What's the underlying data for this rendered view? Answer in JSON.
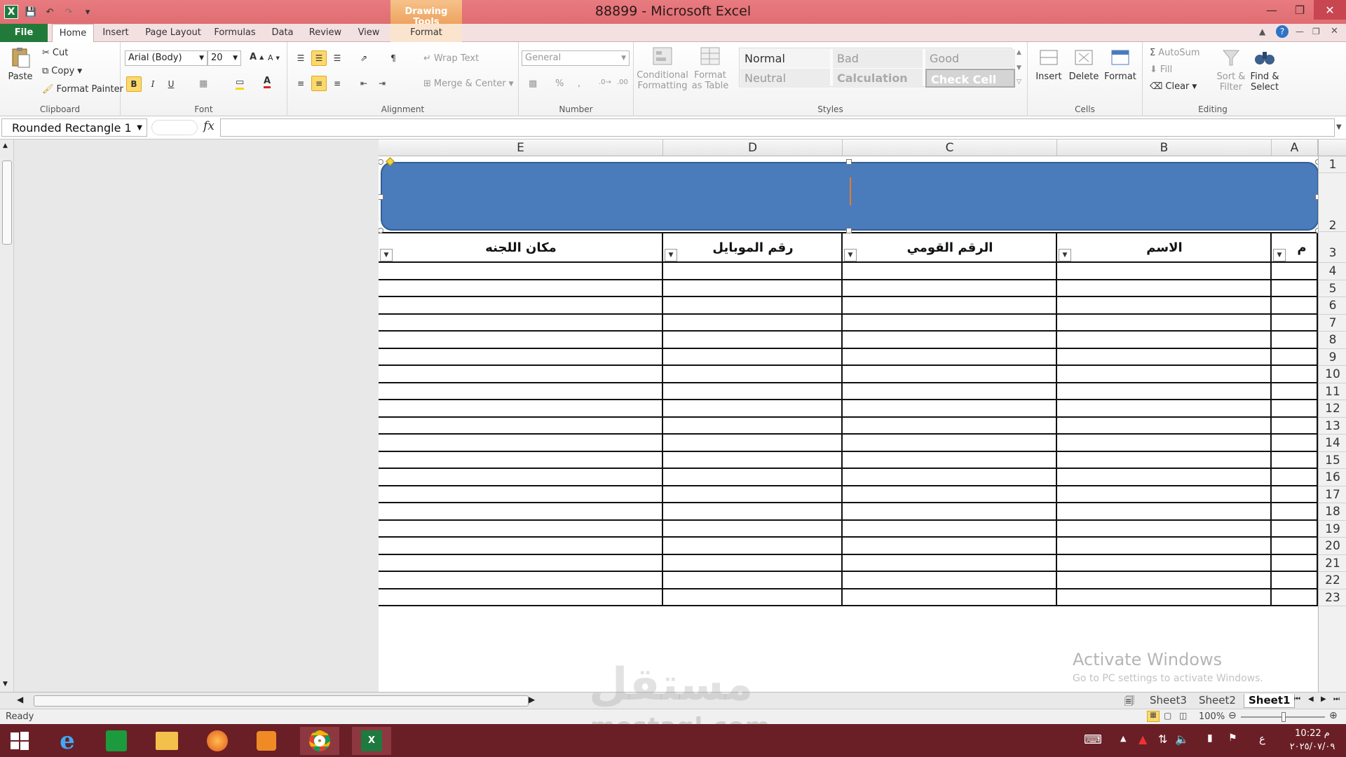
{
  "window": {
    "title": "88899 - Microsoft Excel",
    "context_tab_group": "Drawing Tools"
  },
  "tabs": [
    "File",
    "Home",
    "Insert",
    "Page Layout",
    "Formulas",
    "Data",
    "Review",
    "View",
    "Format"
  ],
  "ribbon": {
    "clipboard": {
      "paste": "Paste",
      "cut": "Cut",
      "copy": "Copy",
      "format_painter": "Format Painter",
      "label": "Clipboard"
    },
    "font": {
      "name": "Arial (Body)",
      "size": "20",
      "bold": "B",
      "italic": "I",
      "underline": "U",
      "label": "Font"
    },
    "alignment": {
      "wrap_text": "Wrap Text",
      "merge_center": "Merge & Center",
      "label": "Alignment"
    },
    "number": {
      "format": "General",
      "percent": "%",
      "comma": ",",
      "label": "Number"
    },
    "styles": {
      "conditional_formatting": "Conditional Formatting",
      "format_as_table": "Format as Table",
      "cells": [
        "Normal",
        "Bad",
        "Good",
        "Neutral",
        "Calculation",
        "Check Cell"
      ],
      "label": "Styles"
    },
    "cells": {
      "insert": "Insert",
      "delete": "Delete",
      "format": "Format",
      "label": "Cells"
    },
    "editing": {
      "autosum": "AutoSum",
      "fill": "Fill",
      "clear": "Clear",
      "sort_filter": "Sort & Filter",
      "find_select": "Find & Select",
      "label": "Editing"
    }
  },
  "formula_bar": {
    "name_box": "Rounded Rectangle 1",
    "fx": "fx",
    "value": ""
  },
  "columns": [
    "E",
    "D",
    "C",
    "B",
    "A"
  ],
  "table_headers": [
    "مكان اللجنه",
    "رقم الموبايل",
    "الرقم القومي",
    "الاسم",
    "م"
  ],
  "rows": [
    "1",
    "2",
    "3",
    "4",
    "5",
    "6",
    "7",
    "8",
    "9",
    "10",
    "11",
    "12",
    "13",
    "14",
    "15",
    "16",
    "17",
    "18",
    "19",
    "20",
    "21",
    "22",
    "23"
  ],
  "sheets": [
    "Sheet3",
    "Sheet2",
    "Sheet1"
  ],
  "active_sheet": "Sheet1",
  "status": {
    "ready": "Ready",
    "zoom": "100%"
  },
  "watermark": {
    "activate_title": "Activate Windows",
    "activate_sub": "Go to PC settings to activate Windows.",
    "brand_ar": "مستقل",
    "brand_en": "mostaql.com"
  },
  "taskbar": {
    "time": "10:22 م",
    "date": "٢٠٢٥/٠٧/٠٩",
    "lang": "ع"
  },
  "colors": {
    "title_bar": "#df6d72",
    "file_tab": "#227a3a",
    "shape_fill": "#4a7cbc",
    "taskbar": "#6a1f26"
  }
}
